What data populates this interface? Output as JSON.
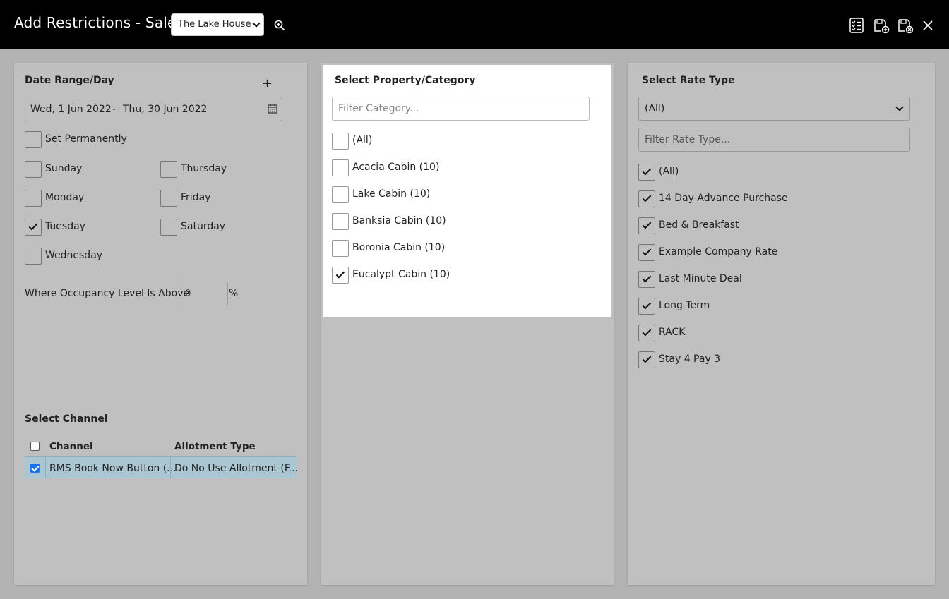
{
  "header": {
    "title": "Add Restrictions - Sale",
    "property_select": "The Lake House"
  },
  "date_panel": {
    "heading": "Date Range/Day",
    "add_label": "+",
    "date_from": "Wed, 1 Jun 2022",
    "date_sep": "-",
    "date_to": "Thu, 30 Jun 2022",
    "set_permanently": "Set Permanently",
    "days": {
      "sunday": "Sunday",
      "monday": "Monday",
      "tuesday": "Tuesday",
      "wednesday": "Wednesday",
      "thursday": "Thursday",
      "friday": "Friday",
      "saturday": "Saturday"
    },
    "occupancy_label": "Where Occupancy Level Is Above",
    "occupancy_value": "0",
    "occupancy_unit": "%"
  },
  "channel": {
    "heading": "Select Channel",
    "col_channel": "Channel",
    "col_allotment": "Allotment Type",
    "rows": [
      {
        "channel": "RMS Book Now Button (...",
        "allotment": "Do No Use Allotment (F...",
        "checked": true
      }
    ]
  },
  "category_panel": {
    "heading": "Select Property/Category",
    "filter_placeholder": "Filter Category...",
    "items": [
      {
        "label": "(All)",
        "checked": false
      },
      {
        "label": "Acacia Cabin (10)",
        "checked": false
      },
      {
        "label": "Lake Cabin (10)",
        "checked": false
      },
      {
        "label": "Banksia Cabin (10)",
        "checked": false
      },
      {
        "label": "Boronia Cabin (10)",
        "checked": false
      },
      {
        "label": "Eucalypt Cabin (10)",
        "checked": true
      }
    ]
  },
  "rate_panel": {
    "heading": "Select Rate Type",
    "select_value": "(All)",
    "filter_placeholder": "Filter Rate Type...",
    "items": [
      {
        "label": "(All)",
        "checked": true
      },
      {
        "label": "14 Day Advance Purchase",
        "checked": true
      },
      {
        "label": "Bed & Breakfast",
        "checked": true
      },
      {
        "label": "Example Company Rate",
        "checked": true
      },
      {
        "label": "Last Minute Deal",
        "checked": true
      },
      {
        "label": "Long Term",
        "checked": true
      },
      {
        "label": "RACK",
        "checked": true
      },
      {
        "label": "Stay 4 Pay 3",
        "checked": true
      }
    ]
  },
  "icons": {
    "checklist": "checklist-icon",
    "save_add": "save-add-icon",
    "save_close": "save-close-icon",
    "close": "close-icon",
    "zoom": "zoom-in-icon",
    "calendar": "calendar-icon"
  },
  "colors": {
    "topbar": "#000000",
    "panel": "#c0c0c0",
    "selected_row": "#a9c6d2",
    "checkbox_accent": "#1a73e8"
  }
}
